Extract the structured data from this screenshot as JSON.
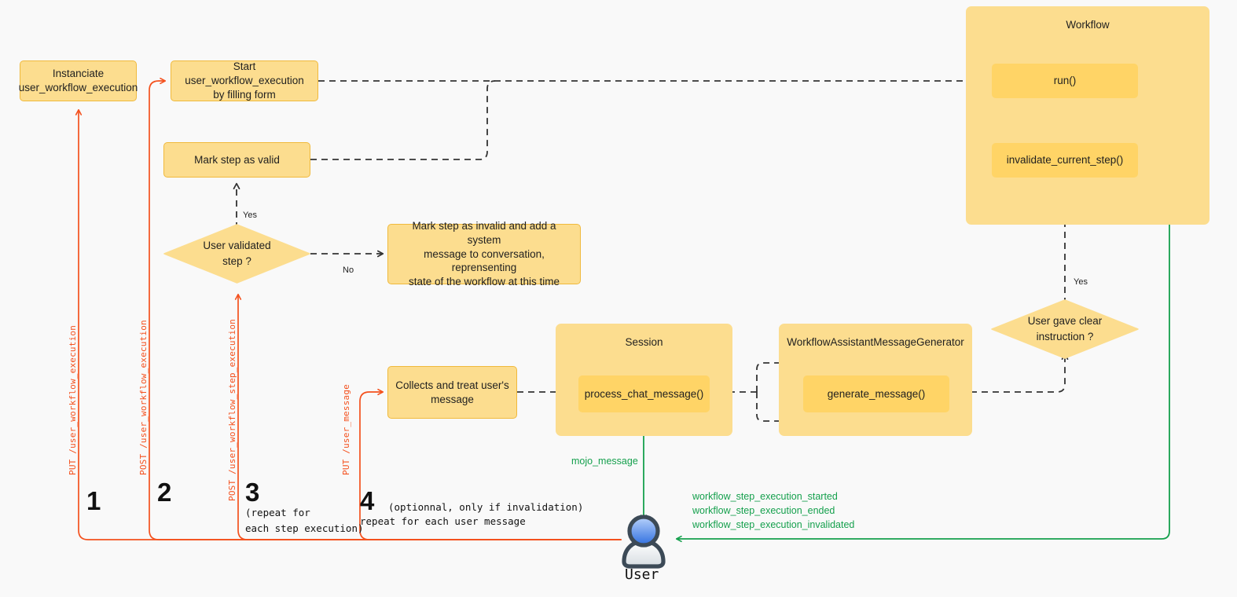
{
  "diagram": {
    "title": "User workflow execution sequence diagram",
    "background_color": "#f9f9f9",
    "colors": {
      "node_fill": "#fcdd8f",
      "node_border": "#f0b93c",
      "method_fill": "#ffd466",
      "container_fill": "#fcdd8f",
      "red": "#f4511e",
      "green": "#15a04d",
      "dash": "#333333",
      "text": "#1f1f1f"
    }
  },
  "nodes": {
    "instanciate": "Instanciate\nuser_workflow_execution",
    "start_exec_l1": "Start user_workflow_execution",
    "start_exec_l2": "by filling form",
    "mark_valid": "Mark step as valid",
    "decision_user_validated_l1": "User validated",
    "decision_user_validated_l2": "step ?",
    "mark_invalid_l1": "Mark step as invalid and add a system",
    "mark_invalid_l2": "message to conversation, reprensenting",
    "mark_invalid_l3": "state of the workflow at this time",
    "collects_l1": "Collects and treat user's",
    "collects_l2": "message",
    "decision_clear_instruction_l1": "User gave clear",
    "decision_clear_instruction_l2": "instruction ?"
  },
  "containers": {
    "workflow": {
      "title": "Workflow",
      "methods": [
        "run()",
        "invalidate_current_step()"
      ]
    },
    "session": {
      "title": "Session",
      "methods": [
        "process_chat_message()"
      ]
    },
    "generator": {
      "title": "WorkflowAssistantMessageGenerator",
      "methods": [
        "generate_message()"
      ]
    }
  },
  "edge_labels": {
    "yes_validated": "Yes",
    "no_validated": "No",
    "yes_clear_instruction": "Yes"
  },
  "api_calls": [
    {
      "id": 1,
      "label": "PUT /user_workflow_execution",
      "number": "1",
      "note": ""
    },
    {
      "id": 2,
      "label": "POST /user_workflow_execution",
      "number": "2",
      "note": ""
    },
    {
      "id": 3,
      "label": "POST /user_workflow_step_execution",
      "number": "3",
      "note": "(repeat for\neach step execution)"
    },
    {
      "id": 4,
      "label": "PUT /user_message",
      "number": "4",
      "note_inline": "(optionnal, only if invalidation)",
      "note_below": "repeat for each user message"
    }
  ],
  "events": {
    "mojo_message": "mojo_message",
    "workflow_events": [
      "workflow_step_execution_started",
      "workflow_step_execution_ended",
      "workflow_step_execution_invalidated"
    ]
  },
  "actor": {
    "label": "User",
    "icon": "user-avatar-icon"
  }
}
